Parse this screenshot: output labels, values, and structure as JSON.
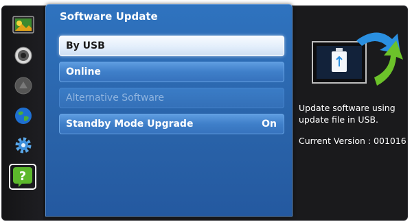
{
  "sidebar": {
    "items": [
      {
        "icon": "picture-icon",
        "selected": false
      },
      {
        "icon": "speaker-icon",
        "selected": false
      },
      {
        "icon": "channel-icon",
        "selected": false
      },
      {
        "icon": "globe-icon",
        "selected": false
      },
      {
        "icon": "gear-icon",
        "selected": false
      },
      {
        "icon": "help-icon",
        "selected": true
      }
    ]
  },
  "panel": {
    "title": "Software Update",
    "items": [
      {
        "label": "By USB",
        "value": "",
        "state": "selected"
      },
      {
        "label": "Online",
        "value": "",
        "state": "normal"
      },
      {
        "label": "Alternative Software",
        "value": "",
        "state": "disabled"
      },
      {
        "label": "Standby Mode Upgrade",
        "value": "On",
        "state": "normal"
      }
    ]
  },
  "info": {
    "description": "Update software using update file in USB.",
    "version": "Current Version : 001016"
  },
  "colors": {
    "panel_blue": "#2f73bf",
    "selected_bg": "#e3eefb",
    "help_green": "#5cb82c",
    "arrow_blue": "#2a8fe0",
    "arrow_green": "#6cc22a"
  }
}
